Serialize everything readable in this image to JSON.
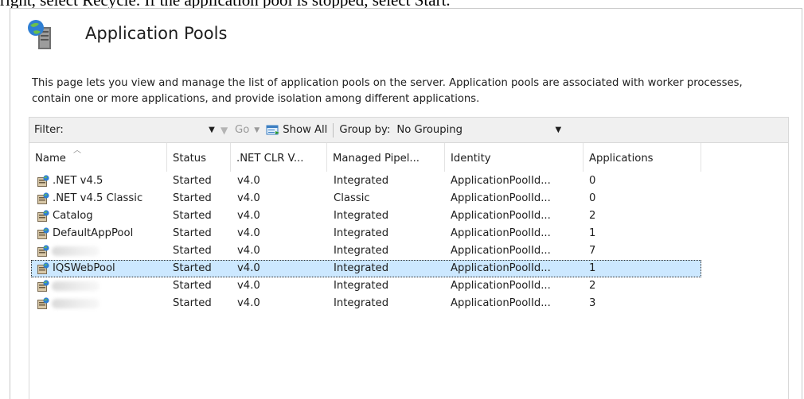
{
  "caption": "right, select Recycle. If the application pool is stopped, select Start.",
  "header": {
    "title": "Application Pools",
    "description": "This page lets you view and manage the list of application pools on the server. Application pools are associated with worker processes, contain one or more applications, and provide isolation among different applications."
  },
  "toolbar": {
    "filter_label": "Filter:",
    "filter_value": "",
    "go_label": "Go",
    "show_all_label": "Show All",
    "group_by_label": "Group by:",
    "group_by_value": "No Grouping"
  },
  "table": {
    "columns": [
      ".NET CLR V...",
      "Managed Pipel...",
      "Identity",
      "Applications"
    ],
    "name_col": "Name",
    "status_col": "Status",
    "rows": [
      {
        "name": ".NET v4.5",
        "status": "Started",
        "clr": "v4.0",
        "pipeline": "Integrated",
        "identity": "ApplicationPoolId...",
        "apps": "0"
      },
      {
        "name": ".NET v4.5 Classic",
        "status": "Started",
        "clr": "v4.0",
        "pipeline": "Classic",
        "identity": "ApplicationPoolId...",
        "apps": "0"
      },
      {
        "name": "Catalog",
        "status": "Started",
        "clr": "v4.0",
        "pipeline": "Integrated",
        "identity": "ApplicationPoolId...",
        "apps": "2"
      },
      {
        "name": "DefaultAppPool",
        "status": "Started",
        "clr": "v4.0",
        "pipeline": "Integrated",
        "identity": "ApplicationPoolId...",
        "apps": "1"
      },
      {
        "name": "",
        "status": "Started",
        "clr": "v4.0",
        "pipeline": "Integrated",
        "identity": "ApplicationPoolId...",
        "apps": "7"
      },
      {
        "name": "IQSWebPool",
        "status": "Started",
        "clr": "v4.0",
        "pipeline": "Integrated",
        "identity": "ApplicationPoolId...",
        "apps": "1",
        "selected": true
      },
      {
        "name": "",
        "status": "Started",
        "clr": "v4.0",
        "pipeline": "Integrated",
        "identity": "ApplicationPoolId...",
        "apps": "2"
      },
      {
        "name": "",
        "status": "Started",
        "clr": "v4.0",
        "pipeline": "Integrated",
        "identity": "ApplicationPoolId...",
        "apps": "3"
      }
    ]
  },
  "icons": {
    "header": "application-pools-icon",
    "row": "application-pool-icon",
    "filter": "funnel-icon",
    "show_all": "show-all-icon"
  },
  "colors": {
    "selection": "#cce8ff",
    "toolbar_bg": "#f0f0f0"
  }
}
